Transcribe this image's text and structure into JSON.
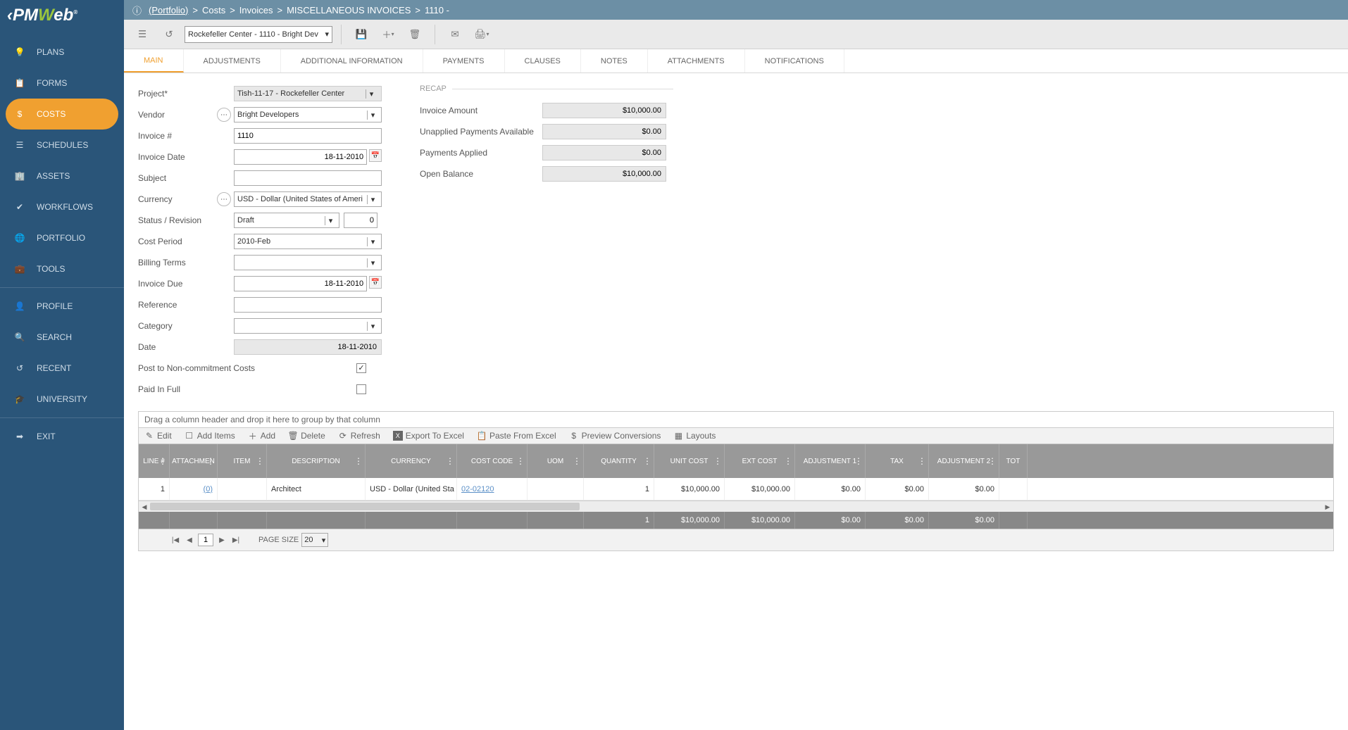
{
  "logo": {
    "pre": "‹PM",
    "w": "W",
    "post": "eb",
    "reg": "®"
  },
  "breadcrumb": {
    "portfolio": "(Portfolio)",
    "a": "Costs",
    "b": "Invoices",
    "c": "MISCELLANEOUS INVOICES",
    "d": "1110 -"
  },
  "toolbar": {
    "project": "Rockefeller Center - 1110 - Bright Dev"
  },
  "sidebar": {
    "items": [
      {
        "label": "PLANS"
      },
      {
        "label": "FORMS"
      },
      {
        "label": "COSTS"
      },
      {
        "label": "SCHEDULES"
      },
      {
        "label": "ASSETS"
      },
      {
        "label": "WORKFLOWS"
      },
      {
        "label": "PORTFOLIO"
      },
      {
        "label": "TOOLS"
      },
      {
        "label": "PROFILE"
      },
      {
        "label": "SEARCH"
      },
      {
        "label": "RECENT"
      },
      {
        "label": "UNIVERSITY"
      },
      {
        "label": "EXIT"
      }
    ]
  },
  "tabs": [
    {
      "label": "MAIN"
    },
    {
      "label": "ADJUSTMENTS"
    },
    {
      "label": "ADDITIONAL INFORMATION"
    },
    {
      "label": "PAYMENTS"
    },
    {
      "label": "CLAUSES"
    },
    {
      "label": "NOTES"
    },
    {
      "label": "ATTACHMENTS"
    },
    {
      "label": "NOTIFICATIONS"
    }
  ],
  "form": {
    "project_label": "Project*",
    "project": "Tish-11-17 - Rockefeller Center",
    "vendor_label": "Vendor",
    "vendor": "Bright Developers",
    "invoice_no_label": "Invoice #",
    "invoice_no": "1110",
    "invoice_date_label": "Invoice Date",
    "invoice_date": "18-11-2010",
    "subject_label": "Subject",
    "subject": "",
    "currency_label": "Currency",
    "currency": "USD - Dollar (United States of Ameri",
    "status_label": "Status / Revision",
    "status": "Draft",
    "revision": "0",
    "cost_period_label": "Cost Period",
    "cost_period": "2010-Feb",
    "billing_terms_label": "Billing Terms",
    "billing_terms": "",
    "invoice_due_label": "Invoice Due",
    "invoice_due": "18-11-2010",
    "reference_label": "Reference",
    "reference": "",
    "category_label": "Category",
    "category": "",
    "date_label": "Date",
    "date": "18-11-2010",
    "post_label": "Post to Non-commitment Costs",
    "paid_label": "Paid In Full"
  },
  "recap": {
    "header": "RECAP",
    "invoice_amount_label": "Invoice Amount",
    "invoice_amount": "$10,000.00",
    "unapplied_label": "Unapplied Payments Available",
    "unapplied": "$0.00",
    "applied_label": "Payments Applied",
    "applied": "$0.00",
    "open_label": "Open Balance",
    "open": "$10,000.00"
  },
  "grid": {
    "groupby": "Drag a column header and drop it here to group by that column",
    "tb": {
      "edit": "Edit",
      "add_items": "Add Items",
      "add": "Add",
      "delete": "Delete",
      "refresh": "Refresh",
      "export": "Export To Excel",
      "paste": "Paste From Excel",
      "preview": "Preview Conversions",
      "layouts": "Layouts"
    },
    "cols": [
      "LINE #",
      "ATTACHMEN",
      "ITEM",
      "DESCRIPTION",
      "CURRENCY",
      "COST CODE",
      "UOM",
      "QUANTITY",
      "UNIT COST",
      "EXT COST",
      "ADJUSTMENT 1",
      "TAX",
      "ADJUSTMENT 2",
      "TOT"
    ],
    "row": {
      "line": "1",
      "attach": "(0)",
      "item": "",
      "desc": "Architect",
      "currency": "USD - Dollar (United Sta",
      "cost_code": "02-02120",
      "uom": "",
      "qty": "1",
      "unit_cost": "$10,000.00",
      "ext_cost": "$10,000.00",
      "adj1": "$0.00",
      "tax": "$0.00",
      "adj2": "$0.00"
    },
    "totals": {
      "qty": "1",
      "unit_cost": "$10,000.00",
      "ext_cost": "$10,000.00",
      "adj1": "$0.00",
      "tax": "$0.00",
      "adj2": "$0.00"
    },
    "pager": {
      "page": "1",
      "page_size_label": "PAGE SIZE",
      "page_size": "20"
    }
  }
}
